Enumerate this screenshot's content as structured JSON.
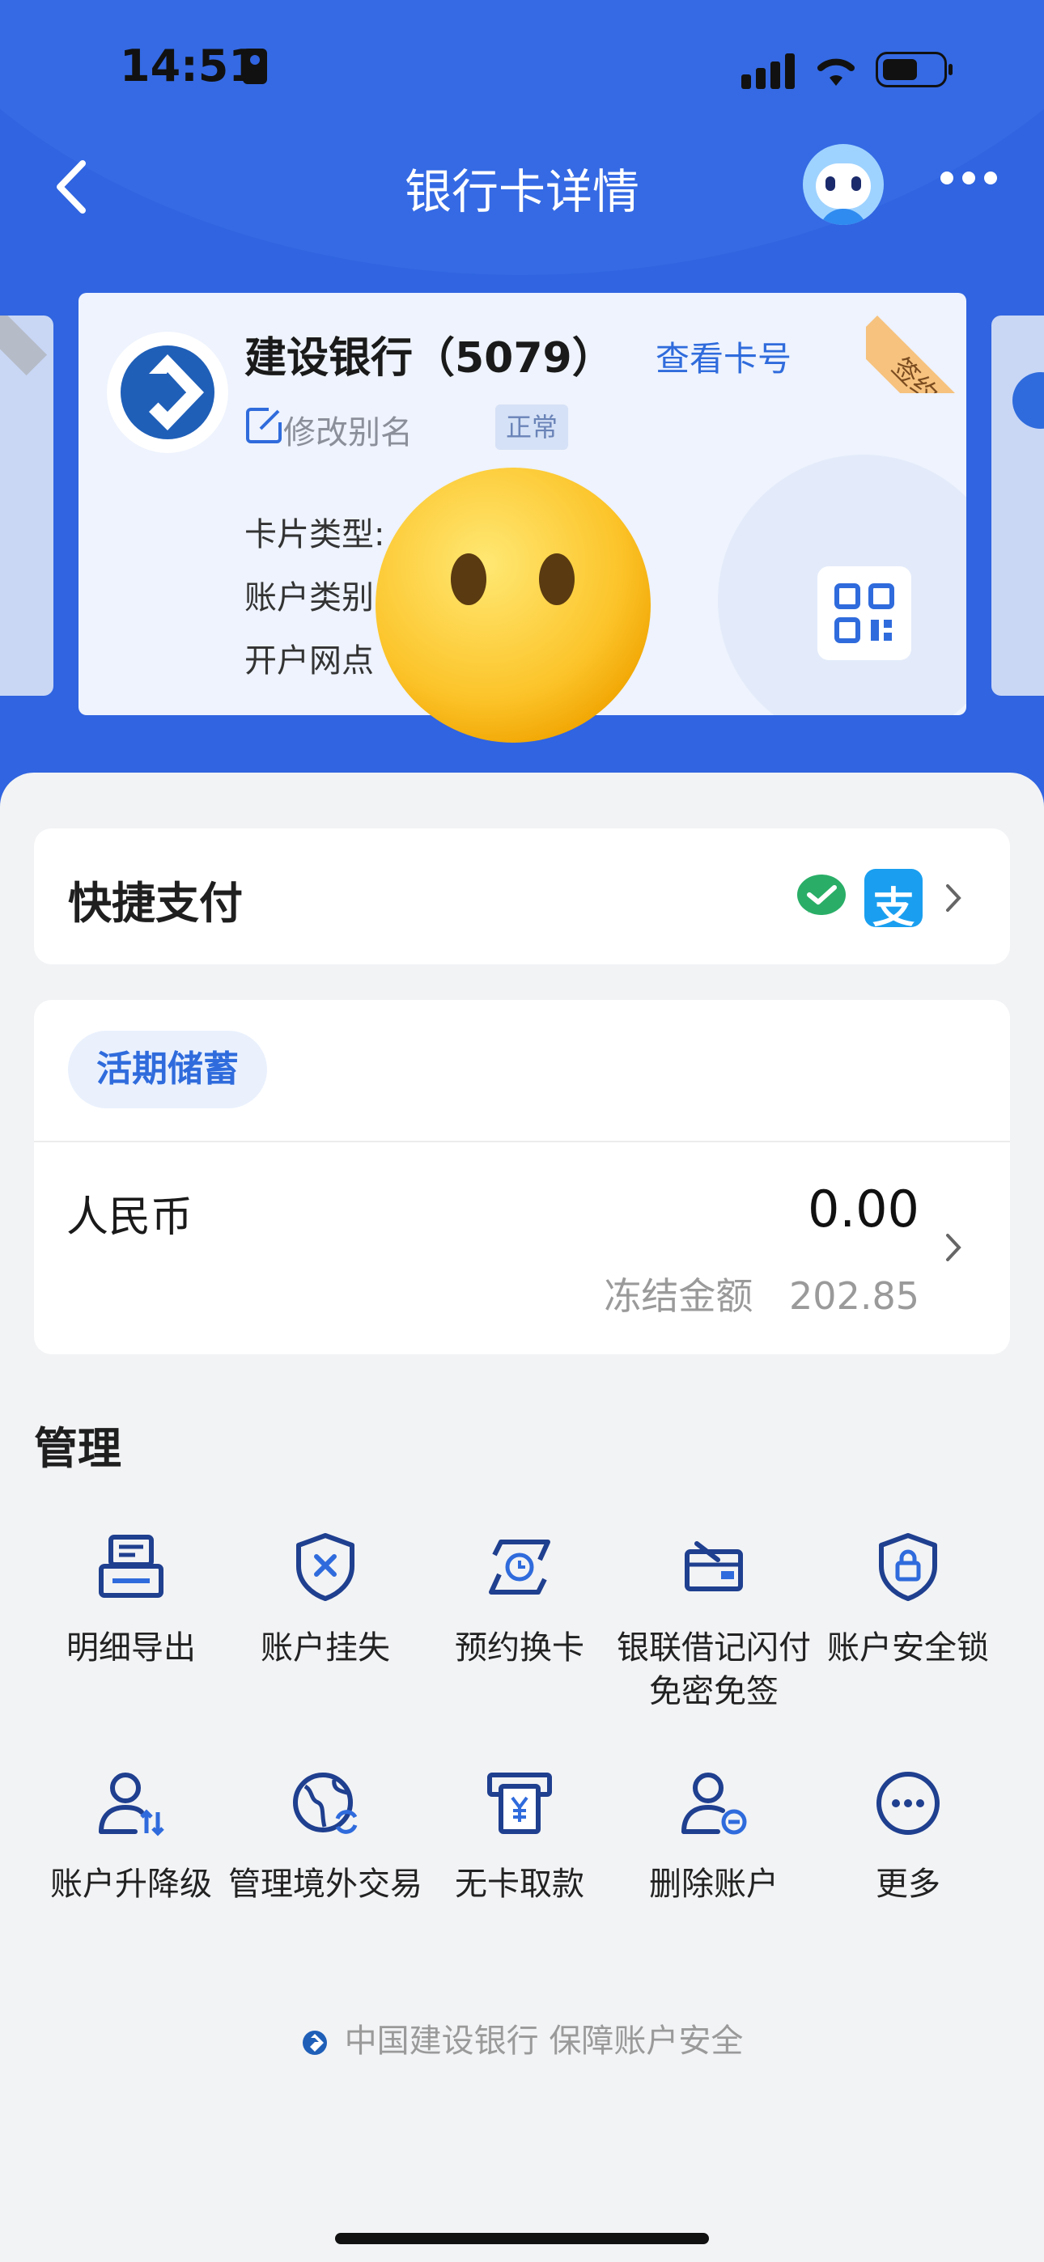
{
  "status_bar": {
    "time": "14:51"
  },
  "header": {
    "title": "银行卡详情"
  },
  "card": {
    "bank_name": "建设银行（5079）",
    "view_card_no": "查看卡号",
    "alias_label": "修改别名",
    "status": "正常",
    "sign_tag": "签约",
    "info": [
      "卡片类型:",
      "账户类别",
      "开户网点"
    ]
  },
  "quick_pay": {
    "title": "快捷支付",
    "icons": [
      "wechat-pay-icon",
      "alipay-icon"
    ]
  },
  "account": {
    "tag": "活期储蓄",
    "currency": "人民币",
    "balance": "0.00",
    "frozen_label": "冻结金额",
    "frozen_amount": "202.85"
  },
  "manage": {
    "title": "管理",
    "items": [
      {
        "label": "明细导出",
        "icon": "printer-icon"
      },
      {
        "label": "账户挂失",
        "icon": "shield-x-icon"
      },
      {
        "label": "预约换卡",
        "icon": "card-exchange-icon"
      },
      {
        "label": "银联借记闪付免密免签",
        "icon": "card-hand-icon"
      },
      {
        "label": "账户安全锁",
        "icon": "shield-lock-icon"
      },
      {
        "label": "账户升降级",
        "icon": "user-updown-icon"
      },
      {
        "label": "管理境外交易",
        "icon": "globe-icon"
      },
      {
        "label": "无卡取款",
        "icon": "atm-icon"
      },
      {
        "label": "删除账户",
        "icon": "user-remove-icon"
      },
      {
        "label": "更多",
        "icon": "more-icon"
      }
    ]
  },
  "footer": {
    "text": "中国建设银行 保障账户安全"
  },
  "colors": {
    "primary": "#3064e0",
    "accent": "#2f6bdc",
    "background": "#f2f3f5"
  }
}
